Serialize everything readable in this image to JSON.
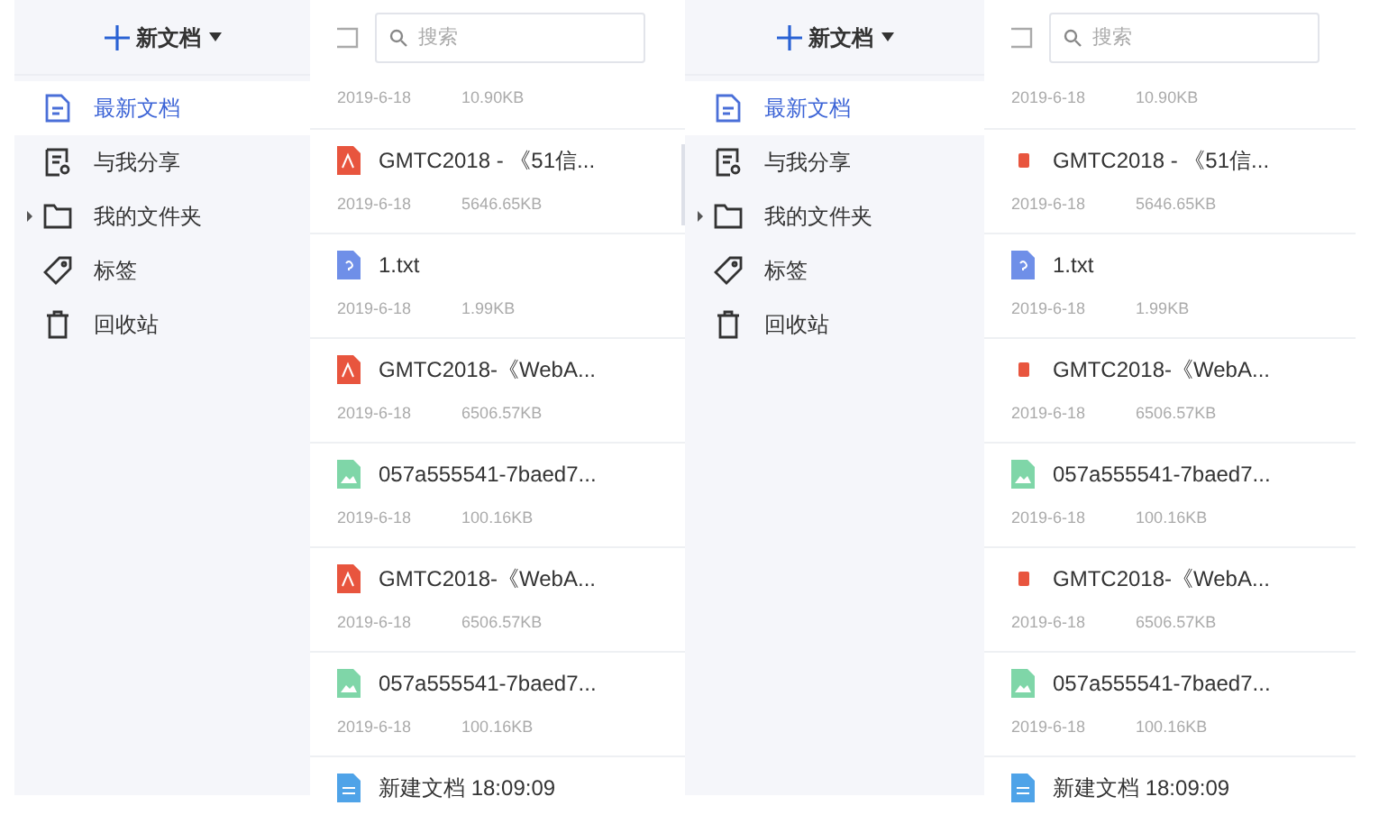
{
  "panels": [
    {
      "new_doc_button": {
        "label": "新文档"
      },
      "nav": [
        {
          "label": "最新文档",
          "kind": "document",
          "selected": true
        },
        {
          "label": "与我分享",
          "kind": "shared",
          "selected": false
        },
        {
          "label": "我的文件夹",
          "kind": "folder",
          "selected": false,
          "expandable": true
        },
        {
          "label": "标签",
          "kind": "tag",
          "selected": false
        },
        {
          "label": "回收站",
          "kind": "trash",
          "selected": false
        }
      ],
      "search": {
        "placeholder": "搜索"
      },
      "files": [
        {
          "date": "2019-6-18",
          "size": "10.90KB"
        },
        {
          "kind": "pdf",
          "name": "GMTC2018 - 《51信...",
          "date": "2019-6-18",
          "size": "5646.65KB"
        },
        {
          "kind": "txt",
          "name": "1.txt",
          "date": "2019-6-18",
          "size": "1.99KB"
        },
        {
          "kind": "pdf",
          "name": "GMTC2018-《WebA...",
          "date": "2019-6-18",
          "size": "6506.57KB"
        },
        {
          "kind": "image",
          "name": "057a555541-7baed7...",
          "date": "2019-6-18",
          "size": "100.16KB"
        },
        {
          "kind": "pdf",
          "name": "GMTC2018-《WebA...",
          "date": "2019-6-18",
          "size": "6506.57KB"
        },
        {
          "kind": "image",
          "name": "057a555541-7baed7...",
          "date": "2019-6-18",
          "size": "100.16KB"
        },
        {
          "kind": "doc",
          "name": "新建文档 18:09:09"
        }
      ]
    },
    {
      "new_doc_button": {
        "label": "新文档"
      },
      "nav": [
        {
          "label": "最新文档",
          "kind": "document",
          "selected": true
        },
        {
          "label": "与我分享",
          "kind": "shared",
          "selected": false
        },
        {
          "label": "我的文件夹",
          "kind": "folder",
          "selected": false,
          "expandable": true
        },
        {
          "label": "标签",
          "kind": "tag",
          "selected": false
        },
        {
          "label": "回收站",
          "kind": "trash",
          "selected": false
        }
      ],
      "search": {
        "placeholder": "搜索"
      },
      "files": [
        {
          "date": "2019-6-18",
          "size": "10.90KB"
        },
        {
          "kind": "pdf_mark",
          "name": "GMTC2018 - 《51信...",
          "date": "2019-6-18",
          "size": "5646.65KB"
        },
        {
          "kind": "txt",
          "name": "1.txt",
          "date": "2019-6-18",
          "size": "1.99KB"
        },
        {
          "kind": "pdf_mark",
          "name": "GMTC2018-《WebA...",
          "date": "2019-6-18",
          "size": "6506.57KB"
        },
        {
          "kind": "image",
          "name": "057a555541-7baed7...",
          "date": "2019-6-18",
          "size": "100.16KB"
        },
        {
          "kind": "pdf_mark",
          "name": "GMTC2018-《WebA...",
          "date": "2019-6-18",
          "size": "6506.57KB"
        },
        {
          "kind": "image",
          "name": "057a555541-7baed7...",
          "date": "2019-6-18",
          "size": "100.16KB"
        },
        {
          "kind": "doc",
          "name": "新建文档 18:09:09"
        }
      ]
    }
  ]
}
